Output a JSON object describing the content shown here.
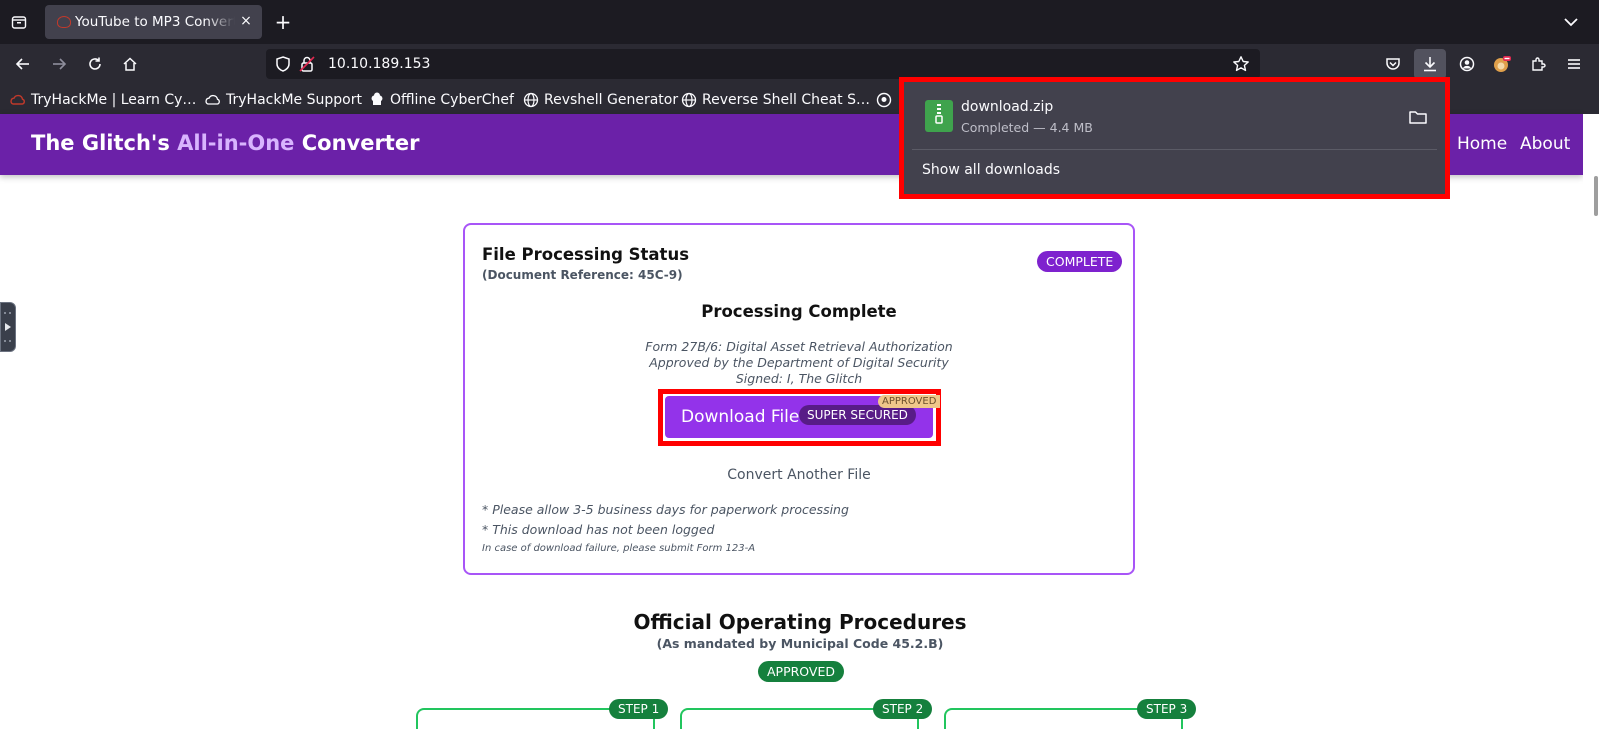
{
  "browser": {
    "tab_title": "YouTube to MP3 Converter",
    "tab_close": "×",
    "new_tab": "+",
    "url": "10.10.189.153",
    "bookmarks": [
      {
        "label": "TryHackMe | Learn Cy…",
        "icon": "tryhackme-icon"
      },
      {
        "label": "TryHackMe Support",
        "icon": "cloud-icon"
      },
      {
        "label": "Offline CyberChef",
        "icon": "chef-icon"
      },
      {
        "label": "Revshell Generator",
        "icon": "globe-icon"
      },
      {
        "label": "Reverse Shell Cheat S…",
        "icon": "globe-icon"
      }
    ]
  },
  "downloads_panel": {
    "file_name": "download.zip",
    "status": "Completed — 4.4 MB",
    "show_all": "Show all downloads"
  },
  "header": {
    "title_part1": "The Glitch's ",
    "title_highlight": "All-in-One",
    "title_part2": " Converter",
    "nav": [
      "Home",
      "About"
    ]
  },
  "status_card": {
    "title": "File Processing Status",
    "reference": "(Document Reference: 45C-9)",
    "badge": "COMPLETE",
    "processing_title": "Processing Complete",
    "form_lines": [
      "Form 27B/6: Digital Asset Retrieval Authorization",
      "Approved by the Department of Digital Security",
      "Signed: I, The Glitch"
    ],
    "download_label": "Download File",
    "secured_label": "SUPER SECURED",
    "approved_tag": "APPROVED",
    "convert_another": "Convert Another File",
    "notes": [
      "* Please allow 3-5 business days for paperwork processing",
      "* This download has not been logged",
      "In case of download failure, please submit Form 123-A"
    ]
  },
  "procedures": {
    "title": "Official Operating Procedures",
    "subtitle": "(As mandated by Municipal Code 45.2.B)",
    "badge": "APPROVED",
    "steps": [
      "STEP 1",
      "STEP 2",
      "STEP 3"
    ]
  },
  "colors": {
    "header_bg": "#6b21a8",
    "accent": "#9333ea",
    "highlight_box": "#ff0000",
    "approved_green": "#15803d"
  }
}
